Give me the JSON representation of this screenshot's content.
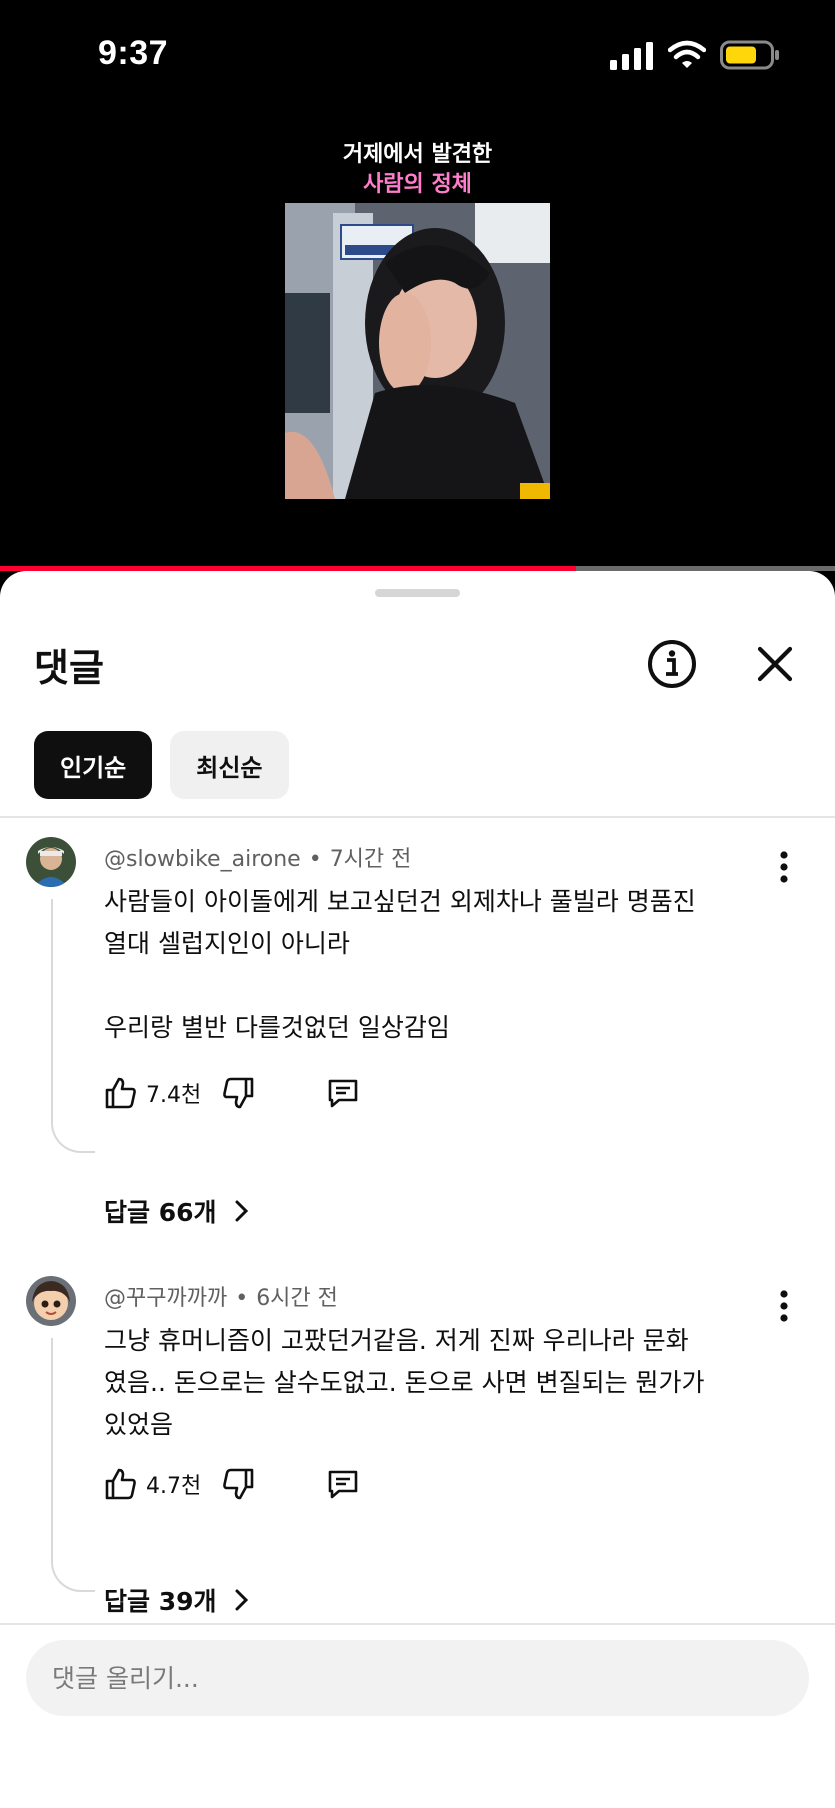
{
  "status_bar": {
    "time": "9:37"
  },
  "video": {
    "caption_line1": "거제에서 발견한",
    "caption_line2": "사람의 정체",
    "caption_accent_color": "#ff7ecb",
    "progress_fraction": 0.69,
    "progress_color": "#ff0033"
  },
  "sheet": {
    "title": "댓글",
    "info_icon": "info-icon",
    "close_icon": "close-icon"
  },
  "sort_chips": [
    {
      "label": "인기순",
      "active": true
    },
    {
      "label": "최신순",
      "active": false
    }
  ],
  "comments": [
    {
      "author": "@slowbike_airone",
      "time": "7시간 전",
      "text_lines": [
        "사람들이 아이돌에게 보고싶던건 외제차나 풀빌라 명품진",
        "열대 셀럽지인이 아니라",
        "",
        "우리랑 별반 다를것없던 일상감임"
      ],
      "likes": "7.4천",
      "replies": "답글 66개"
    },
    {
      "author": "@꾸구까까까",
      "time": "6시간 전",
      "text_lines": [
        "그냥 휴머니즘이 고팠던거같음. 저게 진짜 우리나라 문화",
        "였음.. 돈으로는 살수도없고. 돈으로 사면 변질되는 뭔가가",
        "있었음"
      ],
      "likes": "4.7천",
      "replies": "답글 39개"
    }
  ],
  "compose": {
    "placeholder": "댓글 올리기..."
  }
}
